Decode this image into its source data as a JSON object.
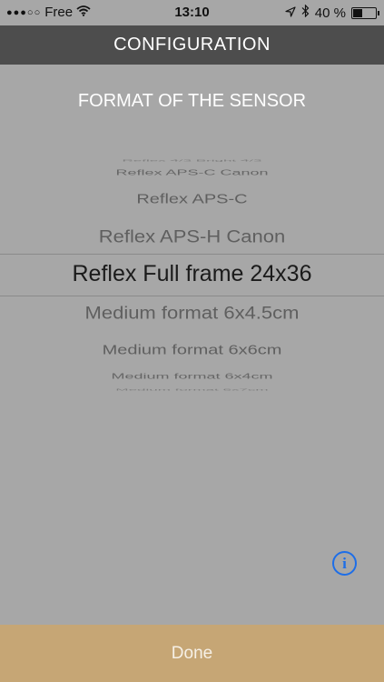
{
  "status_bar": {
    "carrier": "Free",
    "signal_dots": "●●●○○",
    "time": "13:10",
    "battery_percent": "40 %",
    "battery_level": 0.4,
    "icons": [
      "wifi-icon",
      "location-arrow-icon",
      "bluetooth-icon",
      "battery-icon"
    ]
  },
  "navbar": {
    "title": "CONFIGURATION"
  },
  "section": {
    "title": "FORMAT OF THE SENSOR"
  },
  "picker": {
    "options": [
      "Reflex 4/3 Bright 4/3",
      "Reflex APS-C Canon",
      "Reflex APS-C",
      "Reflex APS-H Canon",
      "Reflex Full frame 24x36",
      "Medium format 6x4.5cm",
      "Medium format 6x6cm",
      "Medium format 6x4cm",
      "Medium format 6x7cm"
    ],
    "selected_index": 4
  },
  "info_button": {
    "glyph": "i"
  },
  "footer": {
    "done_label": "Done"
  },
  "colors": {
    "background": "#a7a7a7",
    "navbar": "#4d4d4d",
    "footer": "#c6a675",
    "info_accent": "#1d6ee8"
  }
}
